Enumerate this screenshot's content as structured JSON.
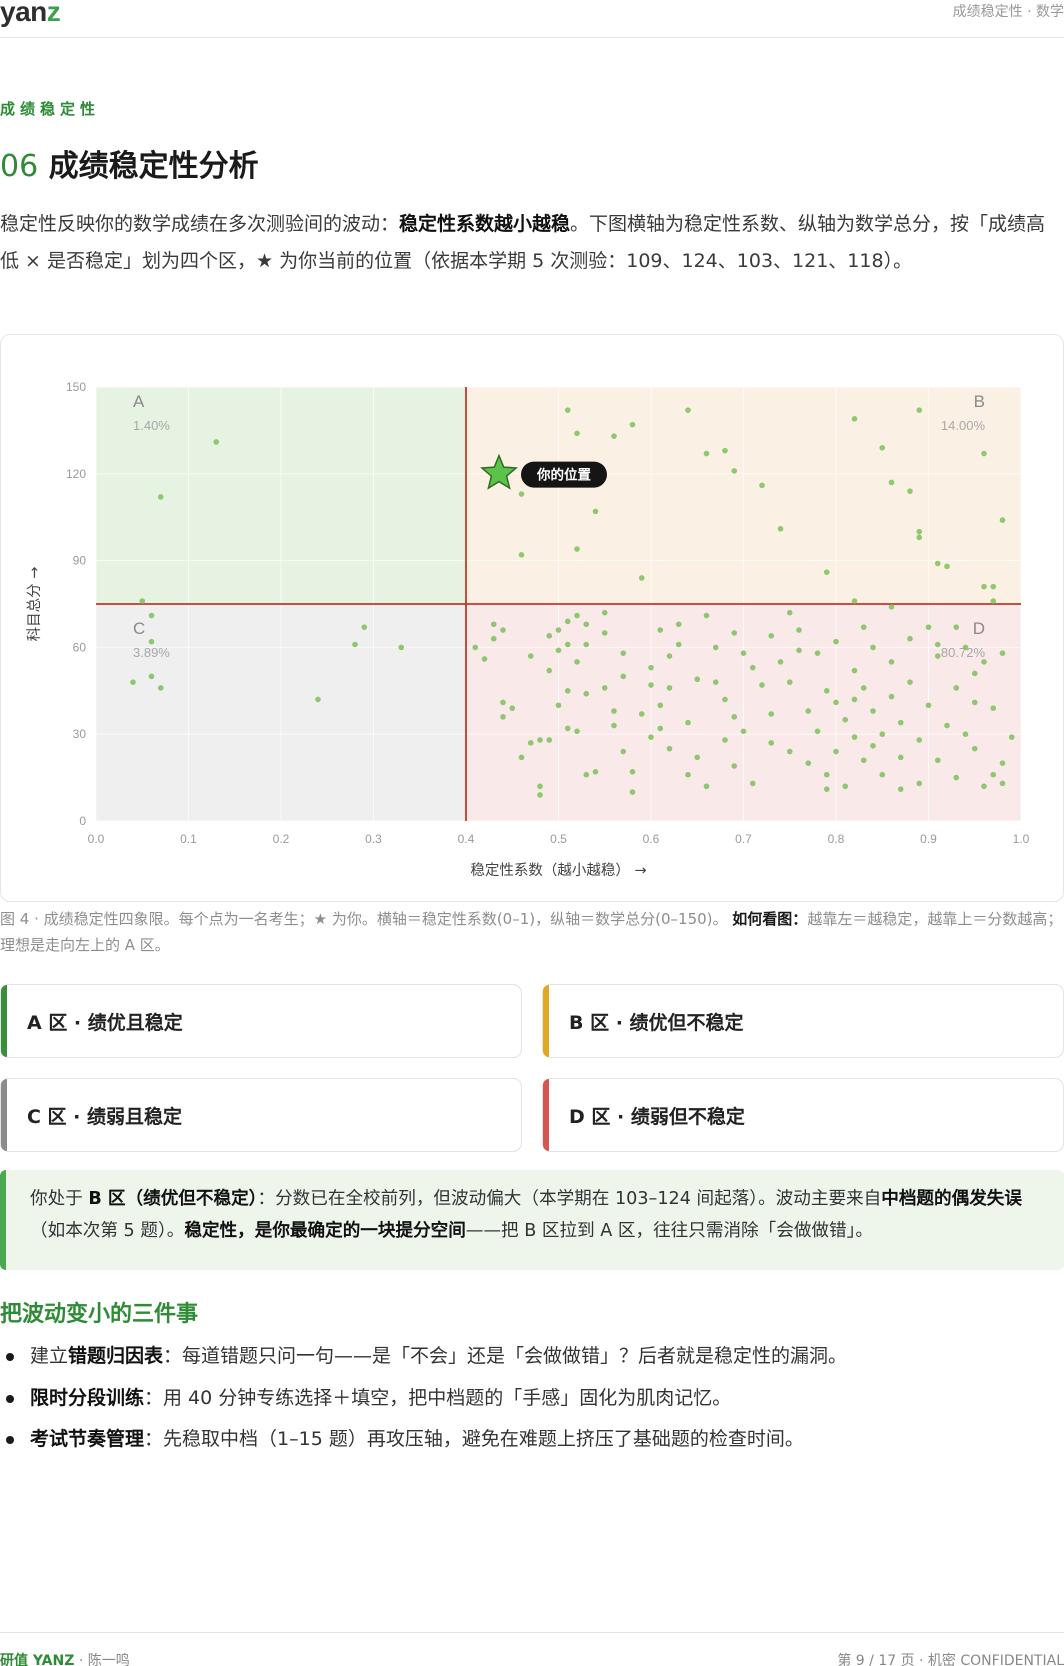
{
  "header": {
    "logo_main": "yan",
    "logo_accent": "z",
    "crumb": "成绩稳定性 · 数学"
  },
  "section": {
    "eyebrow": "成绩稳定性",
    "number": "06",
    "title": "成绩稳定性分析",
    "intro_a": "稳定性反映你的数学成绩在多次测验间的波动：",
    "intro_b": "稳定性系数越小越稳",
    "intro_c": "。下图横轴为稳定性系数、纵轴为数学总分，按「成绩高低 × 是否稳定」划为四个区，★ 为你当前的位置（依据本学期 5 次测验：109、124、103、121、118）。"
  },
  "chart_data": {
    "type": "scatter",
    "xlabel": "稳定性系数（越小越稳） →",
    "ylabel": "科目总分 →",
    "xlim": [
      0,
      1
    ],
    "ylim": [
      0,
      150
    ],
    "xticks": [
      "0.0",
      "0.1",
      "0.2",
      "0.3",
      "0.4",
      "0.5",
      "0.6",
      "0.7",
      "0.8",
      "0.9",
      "1.0"
    ],
    "yticks": [
      "0",
      "30",
      "60",
      "90",
      "120",
      "150"
    ],
    "threshold_x": 0.4,
    "threshold_y": 75,
    "grid": true,
    "quadrants": [
      {
        "name": "A",
        "pct": "1.40%",
        "color": "#e6f2e2"
      },
      {
        "name": "B",
        "pct": "14.00%",
        "color": "#faf0e4"
      },
      {
        "name": "C",
        "pct": "3.89%",
        "color": "#efefef"
      },
      {
        "name": "D",
        "pct": "80.72%",
        "color": "#f9e9e8"
      }
    ],
    "me": {
      "x": 0.44,
      "y": 118,
      "label": "你的位置"
    },
    "points": [
      [
        0.05,
        76
      ],
      [
        0.06,
        71
      ],
      [
        0.07,
        112
      ],
      [
        0.13,
        131
      ],
      [
        0.04,
        48
      ],
      [
        0.06,
        50
      ],
      [
        0.07,
        46
      ],
      [
        0.06,
        62
      ],
      [
        0.24,
        42
      ],
      [
        0.28,
        61
      ],
      [
        0.29,
        67
      ],
      [
        0.33,
        60
      ],
      [
        0.51,
        142
      ],
      [
        0.52,
        134
      ],
      [
        0.56,
        133
      ],
      [
        0.58,
        137
      ],
      [
        0.64,
        142
      ],
      [
        0.66,
        127
      ],
      [
        0.68,
        128
      ],
      [
        0.69,
        121
      ],
      [
        0.72,
        116
      ],
      [
        0.74,
        101
      ],
      [
        0.82,
        139
      ],
      [
        0.89,
        142
      ],
      [
        0.85,
        129
      ],
      [
        0.96,
        127
      ],
      [
        0.86,
        117
      ],
      [
        0.88,
        114
      ],
      [
        0.89,
        98
      ],
      [
        0.89,
        100
      ],
      [
        0.98,
        104
      ],
      [
        0.91,
        89
      ],
      [
        0.92,
        88
      ],
      [
        0.46,
        92
      ],
      [
        0.52,
        94
      ],
      [
        0.54,
        107
      ],
      [
        0.46,
        113
      ],
      [
        0.59,
        84
      ],
      [
        0.79,
        86
      ],
      [
        0.96,
        81
      ],
      [
        0.97,
        81
      ],
      [
        0.97,
        76
      ],
      [
        0.82,
        76
      ],
      [
        0.86,
        74
      ],
      [
        0.41,
        60
      ],
      [
        0.42,
        56
      ],
      [
        0.43,
        68
      ],
      [
        0.43,
        63
      ],
      [
        0.44,
        66
      ],
      [
        0.44,
        41
      ],
      [
        0.45,
        39
      ],
      [
        0.46,
        22
      ],
      [
        0.47,
        27
      ],
      [
        0.48,
        28
      ],
      [
        0.48,
        12
      ],
      [
        0.48,
        9
      ],
      [
        0.49,
        64
      ],
      [
        0.49,
        52
      ],
      [
        0.49,
        28
      ],
      [
        0.5,
        66
      ],
      [
        0.5,
        59
      ],
      [
        0.51,
        69
      ],
      [
        0.51,
        61
      ],
      [
        0.51,
        45
      ],
      [
        0.51,
        32
      ],
      [
        0.52,
        71
      ],
      [
        0.52,
        55
      ],
      [
        0.52,
        31
      ],
      [
        0.53,
        68
      ],
      [
        0.53,
        61
      ],
      [
        0.53,
        44
      ],
      [
        0.54,
        17
      ],
      [
        0.55,
        72
      ],
      [
        0.55,
        65
      ],
      [
        0.55,
        46
      ],
      [
        0.56,
        38
      ],
      [
        0.56,
        33
      ],
      [
        0.57,
        58
      ],
      [
        0.57,
        24
      ],
      [
        0.58,
        17
      ],
      [
        0.58,
        10
      ],
      [
        0.59,
        37
      ],
      [
        0.6,
        53
      ],
      [
        0.6,
        47
      ],
      [
        0.61,
        66
      ],
      [
        0.61,
        40
      ],
      [
        0.61,
        32
      ],
      [
        0.62,
        57
      ],
      [
        0.62,
        25
      ],
      [
        0.63,
        68
      ],
      [
        0.63,
        61
      ],
      [
        0.64,
        34
      ],
      [
        0.64,
        16
      ],
      [
        0.65,
        49
      ],
      [
        0.65,
        22
      ],
      [
        0.66,
        12
      ],
      [
        0.67,
        60
      ],
      [
        0.67,
        48
      ],
      [
        0.68,
        42
      ],
      [
        0.68,
        28
      ],
      [
        0.69,
        65
      ],
      [
        0.69,
        36
      ],
      [
        0.69,
        19
      ],
      [
        0.7,
        58
      ],
      [
        0.7,
        31
      ],
      [
        0.71,
        13
      ],
      [
        0.72,
        47
      ],
      [
        0.73,
        64
      ],
      [
        0.73,
        27
      ],
      [
        0.74,
        55
      ],
      [
        0.75,
        72
      ],
      [
        0.75,
        48
      ],
      [
        0.75,
        24
      ],
      [
        0.76,
        66
      ],
      [
        0.77,
        38
      ],
      [
        0.77,
        20
      ],
      [
        0.78,
        58
      ],
      [
        0.78,
        31
      ],
      [
        0.79,
        45
      ],
      [
        0.79,
        16
      ],
      [
        0.8,
        62
      ],
      [
        0.8,
        41
      ],
      [
        0.8,
        24
      ],
      [
        0.81,
        35
      ],
      [
        0.81,
        12
      ],
      [
        0.82,
        52
      ],
      [
        0.82,
        29
      ],
      [
        0.83,
        67
      ],
      [
        0.83,
        46
      ],
      [
        0.83,
        21
      ],
      [
        0.84,
        60
      ],
      [
        0.84,
        38
      ],
      [
        0.85,
        30
      ],
      [
        0.85,
        16
      ],
      [
        0.86,
        55
      ],
      [
        0.86,
        43
      ],
      [
        0.87,
        22
      ],
      [
        0.87,
        34
      ],
      [
        0.88,
        63
      ],
      [
        0.88,
        48
      ],
      [
        0.89,
        28
      ],
      [
        0.89,
        13
      ],
      [
        0.9,
        67
      ],
      [
        0.9,
        40
      ],
      [
        0.91,
        21
      ],
      [
        0.91,
        57
      ],
      [
        0.92,
        33
      ],
      [
        0.93,
        67
      ],
      [
        0.93,
        46
      ],
      [
        0.93,
        15
      ],
      [
        0.94,
        60
      ],
      [
        0.94,
        30
      ],
      [
        0.95,
        41
      ],
      [
        0.95,
        25
      ],
      [
        0.96,
        55
      ],
      [
        0.96,
        12
      ],
      [
        0.97,
        39
      ],
      [
        0.97,
        16
      ],
      [
        0.98,
        58
      ],
      [
        0.98,
        13
      ],
      [
        0.99,
        29
      ],
      [
        0.44,
        36
      ],
      [
        0.47,
        57
      ],
      [
        0.5,
        40
      ],
      [
        0.53,
        16
      ],
      [
        0.57,
        50
      ],
      [
        0.6,
        29
      ],
      [
        0.62,
        46
      ],
      [
        0.66,
        71
      ],
      [
        0.71,
        53
      ],
      [
        0.73,
        37
      ],
      [
        0.76,
        59
      ],
      [
        0.79,
        11
      ],
      [
        0.82,
        42
      ],
      [
        0.84,
        26
      ],
      [
        0.87,
        11
      ],
      [
        0.91,
        61
      ],
      [
        0.95,
        51
      ],
      [
        0.98,
        20
      ]
    ]
  },
  "caption": {
    "text_a": "图 4 · 成绩稳定性四象限。每个点为一名考生；★ 为你。横轴＝稳定性系数(0–1)，纵轴＝数学总分(0–150)。",
    "text_b": "如何看图：",
    "text_c": "越靠左＝越稳定，越靠上＝分数越高；理想是走向左上的 A 区。"
  },
  "cards": [
    {
      "label": "A 区 · 绩优且稳定",
      "color": "#3a8f3d"
    },
    {
      "label": "B 区 · 绩优但不稳定",
      "color": "#e2a823"
    },
    {
      "label": "C 区 · 绩弱且稳定",
      "color": "#8c8c8c"
    },
    {
      "label": "D 区 · 绩弱但不稳定",
      "color": "#d9534f"
    }
  ],
  "callout": {
    "a": "你处于 ",
    "b": "B 区（绩优但不稳定）",
    "c": "：分数已在全校前列，但波动偏大（本学期在 103–124 间起落）。波动主要来自",
    "d": "中档题的偶发失误",
    "e": "（如本次第 5 题）。",
    "f": "稳定性，是你最确定的一块提分空间",
    "g": "——把 B 区拉到 A 区，往往只需消除「会做做错」。"
  },
  "tips": {
    "title": "把波动变小的三件事",
    "items": [
      {
        "pre": "建立",
        "bold": "错题归因表",
        "rest": "：每道错题只问一句——是「不会」还是「会做做错」？后者就是稳定性的漏洞。"
      },
      {
        "pre": "",
        "bold": "限时分段训练",
        "rest": "：用 40 分钟专练选择＋填空，把中档题的「手感」固化为肌肉记忆。"
      },
      {
        "pre": "",
        "bold": "考试节奏管理",
        "rest": "：先稳取中档（1–15 题）再攻压轴，避免在难题上挤压了基础题的检查时间。"
      }
    ]
  },
  "footer": {
    "brand": "研值 YANZ",
    "student": " · 陈一鸣",
    "page": "第 9 / 17 页 · 机密 CONFIDENTIAL"
  }
}
